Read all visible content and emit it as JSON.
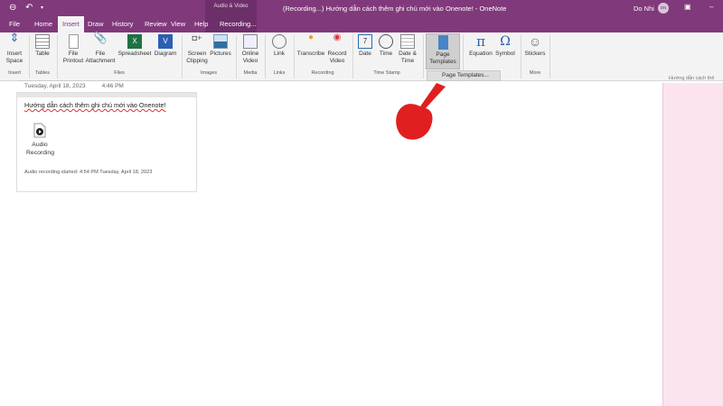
{
  "window": {
    "title": "(Recording...) Hướng dẫn cách thêm ghi chú mới vào Onenote! - OneNote",
    "user": "Do Nhi",
    "avatar_initials": "DN",
    "context_tab_group": "Audio & Video"
  },
  "tabs": [
    {
      "label": "File"
    },
    {
      "label": "Home"
    },
    {
      "label": "Insert",
      "active": true
    },
    {
      "label": "Draw"
    },
    {
      "label": "History"
    },
    {
      "label": "Review"
    },
    {
      "label": "View"
    },
    {
      "label": "Help"
    },
    {
      "label": "Recording..."
    }
  ],
  "ribbon": {
    "buttons": {
      "insert_space": "Insert Space",
      "table": "Table",
      "file_printout": "File Printout",
      "file_attachment": "File Attachment",
      "spreadsheet": "Spreadsheet",
      "diagram": "Diagram",
      "screen_clipping": "Screen Clipping",
      "pictures": "Pictures",
      "online_video": "Online Video",
      "link": "Link",
      "transcribe": "Transcribe",
      "record_video": "Record Video",
      "date": "Date",
      "time": "Time",
      "date_time": "Date & Time",
      "page_templates": "Page Templates",
      "equation": "Equation",
      "symbol": "Symbol",
      "stickers": "Stickers"
    },
    "groups": {
      "insert": "Insert",
      "tables": "Tables",
      "files": "Files",
      "images": "Images",
      "media": "Media",
      "links": "Links",
      "recording": "Recording",
      "time_stamp": "Time Stamp",
      "more": "More"
    }
  },
  "dropdown": {
    "item": "Page Templates..."
  },
  "page": {
    "date": "Tuesday, April 18, 2023",
    "time": "4:46 PM",
    "note_text": "Hướng dẫn cách thêm ghi chú mới vào Onenote",
    "note_suffix": "!",
    "audio_label": "Audio Recording",
    "recording_info": "Audio recording started: 4:54 PM Tuesday, April 18, 2023"
  },
  "sidebar": {
    "page_title": "Hướng dẫn cách thê"
  },
  "colors": {
    "accent": "#80397b",
    "sidebar": "#fce4ef",
    "pointer": "#e02020"
  }
}
